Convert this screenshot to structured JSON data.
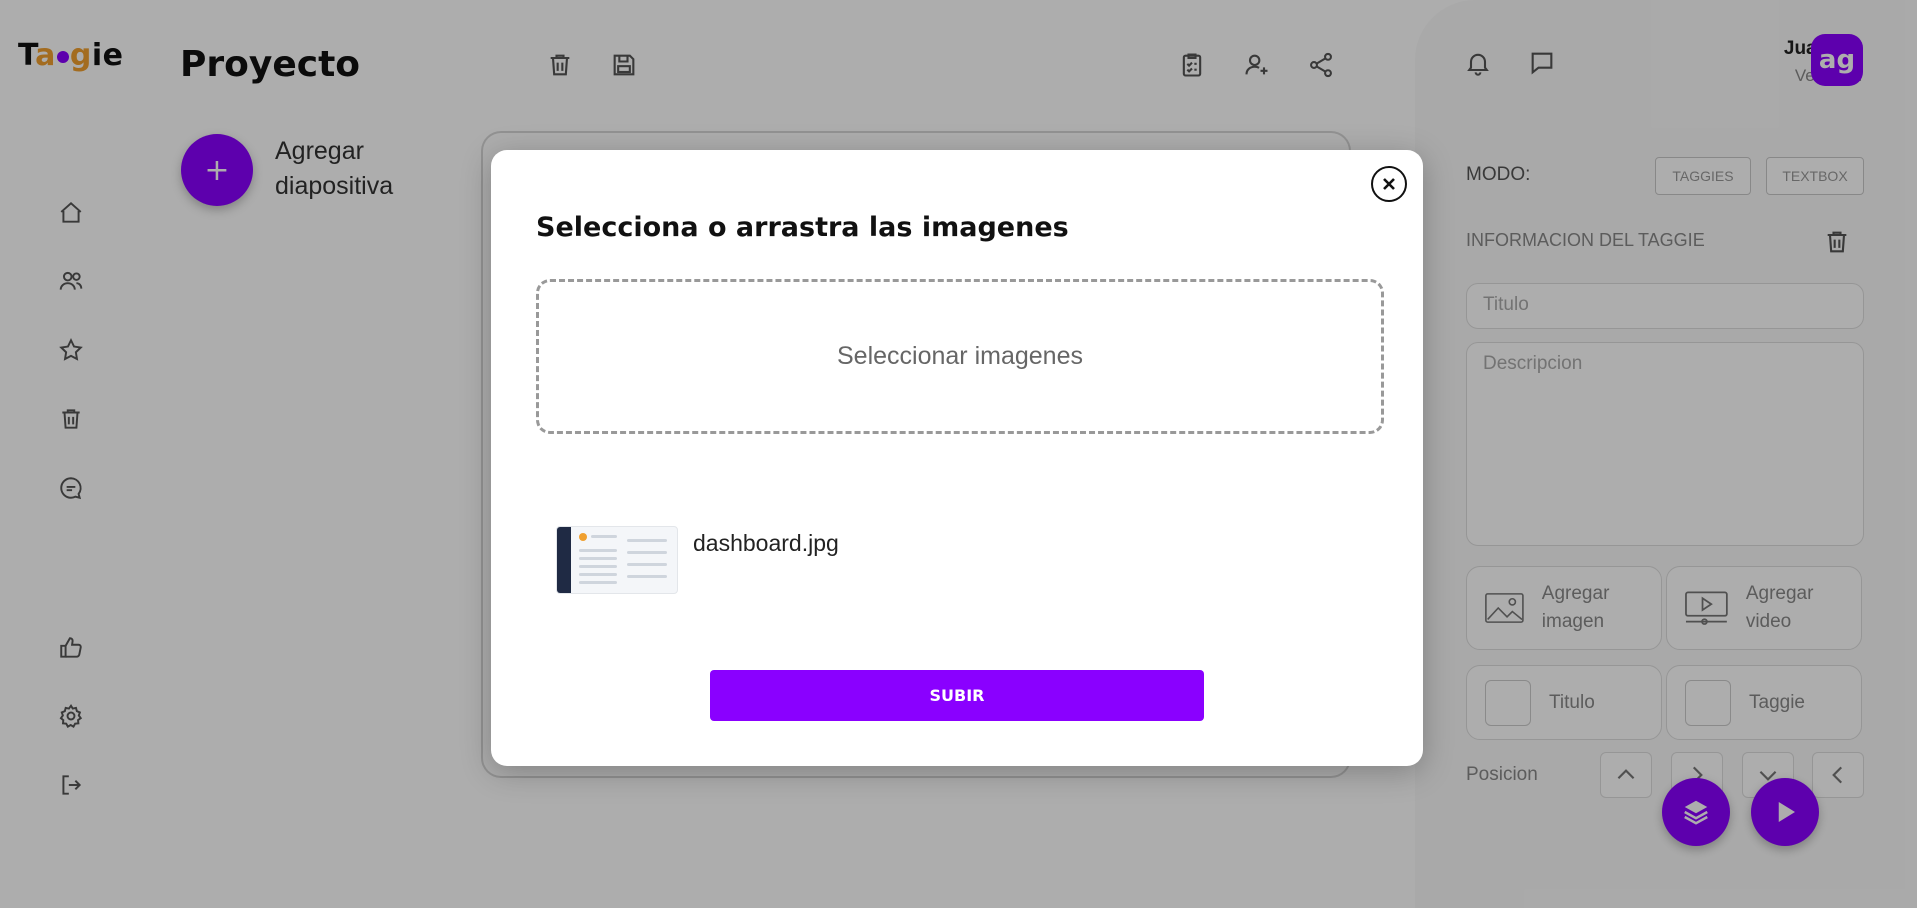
{
  "app": {
    "logo_text": "Taggie"
  },
  "sidebar": {
    "items": [
      {
        "icon": "home-icon"
      },
      {
        "icon": "users-icon"
      },
      {
        "icon": "star-icon"
      },
      {
        "icon": "trash-icon"
      },
      {
        "icon": "chat-icon"
      },
      {
        "icon": "thumbs-up-icon"
      },
      {
        "icon": "gear-icon"
      },
      {
        "icon": "logout-icon"
      }
    ]
  },
  "header": {
    "title": "Proyecto",
    "icons": [
      "trash-icon",
      "save-icon",
      "clipboard-check-icon",
      "add-user-icon",
      "share-icon"
    ]
  },
  "main": {
    "add_slide_label": "Agregar diapositiva",
    "add_slide_symbol": "+"
  },
  "user": {
    "name": "Juancho",
    "profile_link": "Ver perfil",
    "avatar_text": "ag"
  },
  "right_panel": {
    "mode_label": "MODO:",
    "mode_options": [
      "TAGGIES",
      "TEXTBOX"
    ],
    "section_title": "INFORMACION DEL TAGGIE",
    "title_placeholder": "Titulo",
    "description_placeholder": "Descripcion",
    "add_image_label": "Agregar imagen",
    "add_video_label": "Agregar video",
    "title_tile_label": "Titulo",
    "taggie_tile_label": "Taggie",
    "position_label": "Posicion"
  },
  "modal": {
    "title": "Selecciona o arrastra las imagenes",
    "dropzone_label": "Seleccionar imagenes",
    "file_name": "dashboard.jpg",
    "upload_label": "SUBIR"
  },
  "colors": {
    "accent": "#8a00ff",
    "overlay": "rgba(0,0,0,0.32)"
  }
}
